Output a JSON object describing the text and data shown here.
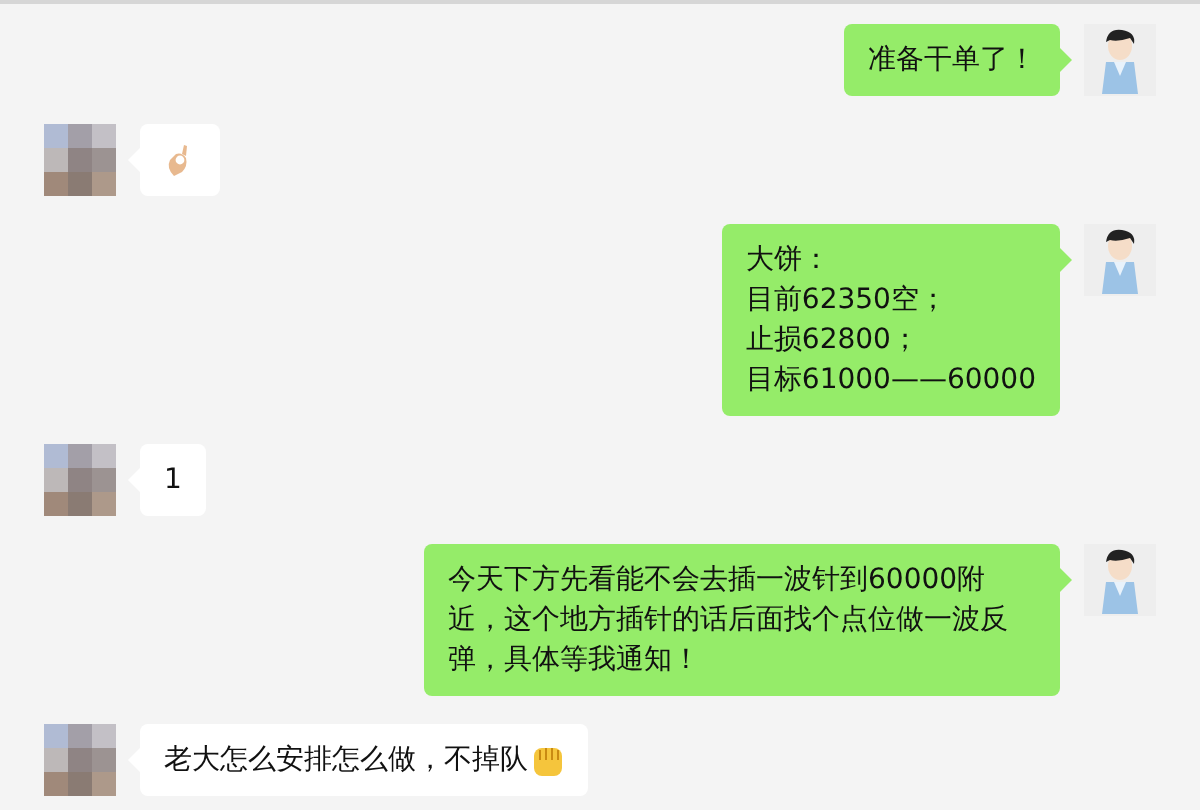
{
  "messages": [
    {
      "outgoing": true,
      "kind": "text",
      "lines": [
        "准备干单了！"
      ]
    },
    {
      "outgoing": false,
      "kind": "icon"
    },
    {
      "outgoing": true,
      "kind": "text",
      "lines": [
        "大饼：",
        "目前62350空；",
        "止损62800；",
        "目标61000——60000"
      ]
    },
    {
      "outgoing": false,
      "kind": "text",
      "lines": [
        "1"
      ]
    },
    {
      "outgoing": true,
      "kind": "text",
      "lines": [
        "今天下方先看能不会去插一波针到60000附近，这个地方插针的话后面找个点位做一波反弹，具体等我通知！"
      ]
    },
    {
      "outgoing": false,
      "kind": "text_icon",
      "lines": [
        "老大怎么安排怎么做，不掉队"
      ]
    }
  ]
}
